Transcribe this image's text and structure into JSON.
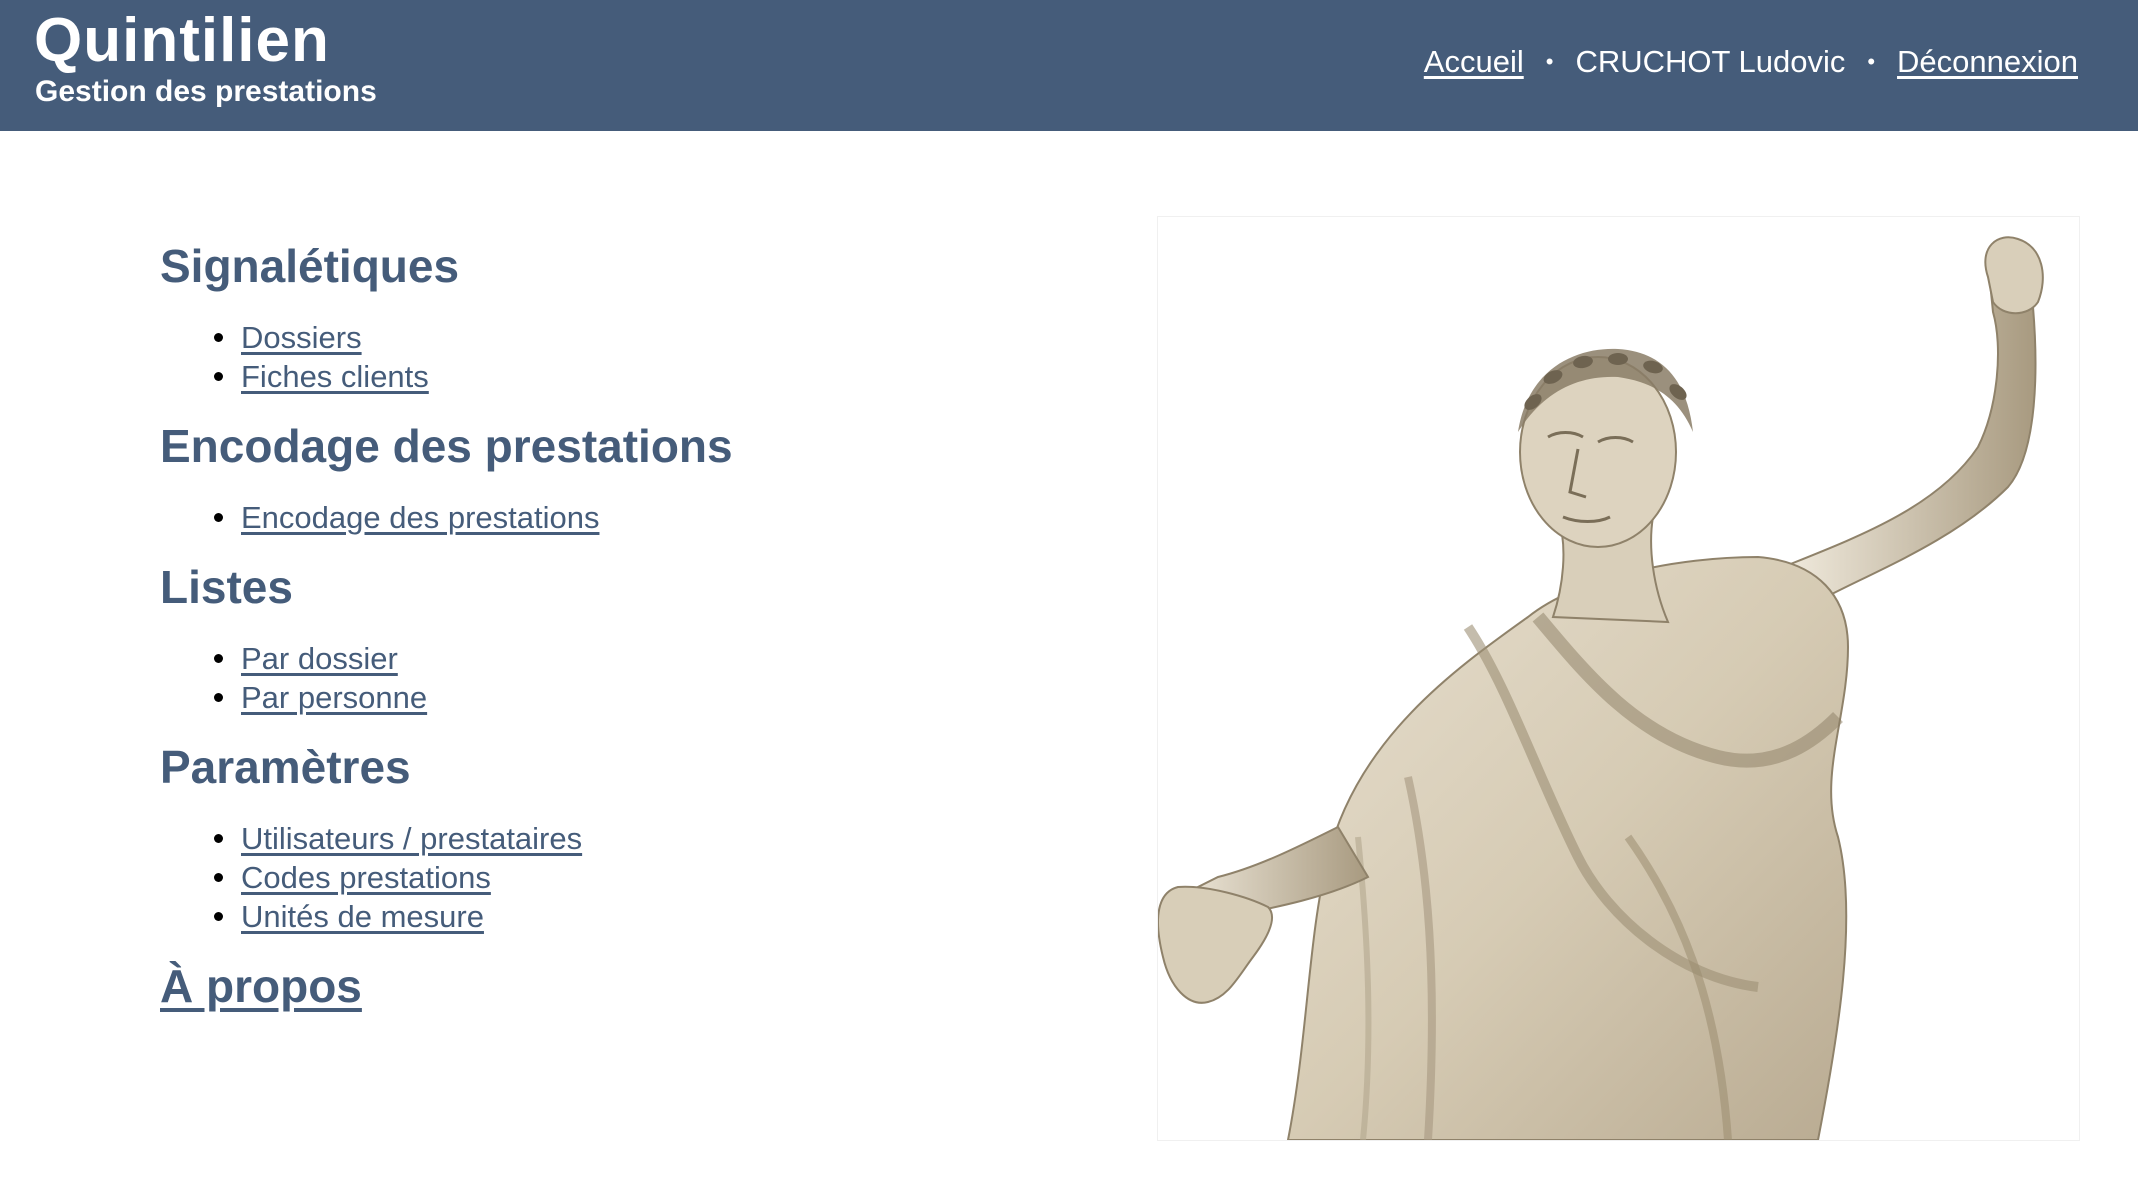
{
  "header": {
    "app_title": "Quintilien",
    "app_subtitle": "Gestion des prestations",
    "nav": {
      "home_label": "Accueil",
      "user_name": "CRUCHOT Ludovic",
      "logout_label": "Déconnexion",
      "separator": "•"
    }
  },
  "menu": {
    "sections": [
      {
        "title": "Signalétiques",
        "items": [
          "Dossiers",
          "Fiches clients"
        ]
      },
      {
        "title": "Encodage des prestations",
        "items": [
          "Encodage des prestations"
        ]
      },
      {
        "title": "Listes",
        "items": [
          "Par dossier",
          "Par personne"
        ]
      },
      {
        "title": "Paramètres",
        "items": [
          "Utilisateurs / prestataires",
          "Codes prestations",
          "Unités de mesure"
        ]
      }
    ],
    "about_label": "À propos"
  },
  "illustration": {
    "subject": "marble statue of a laurel-crowned orator in a toga",
    "icon": "statue-image"
  },
  "colors": {
    "header_bg": "#455c7a",
    "heading": "#455c7a",
    "link": "#455c7a"
  }
}
